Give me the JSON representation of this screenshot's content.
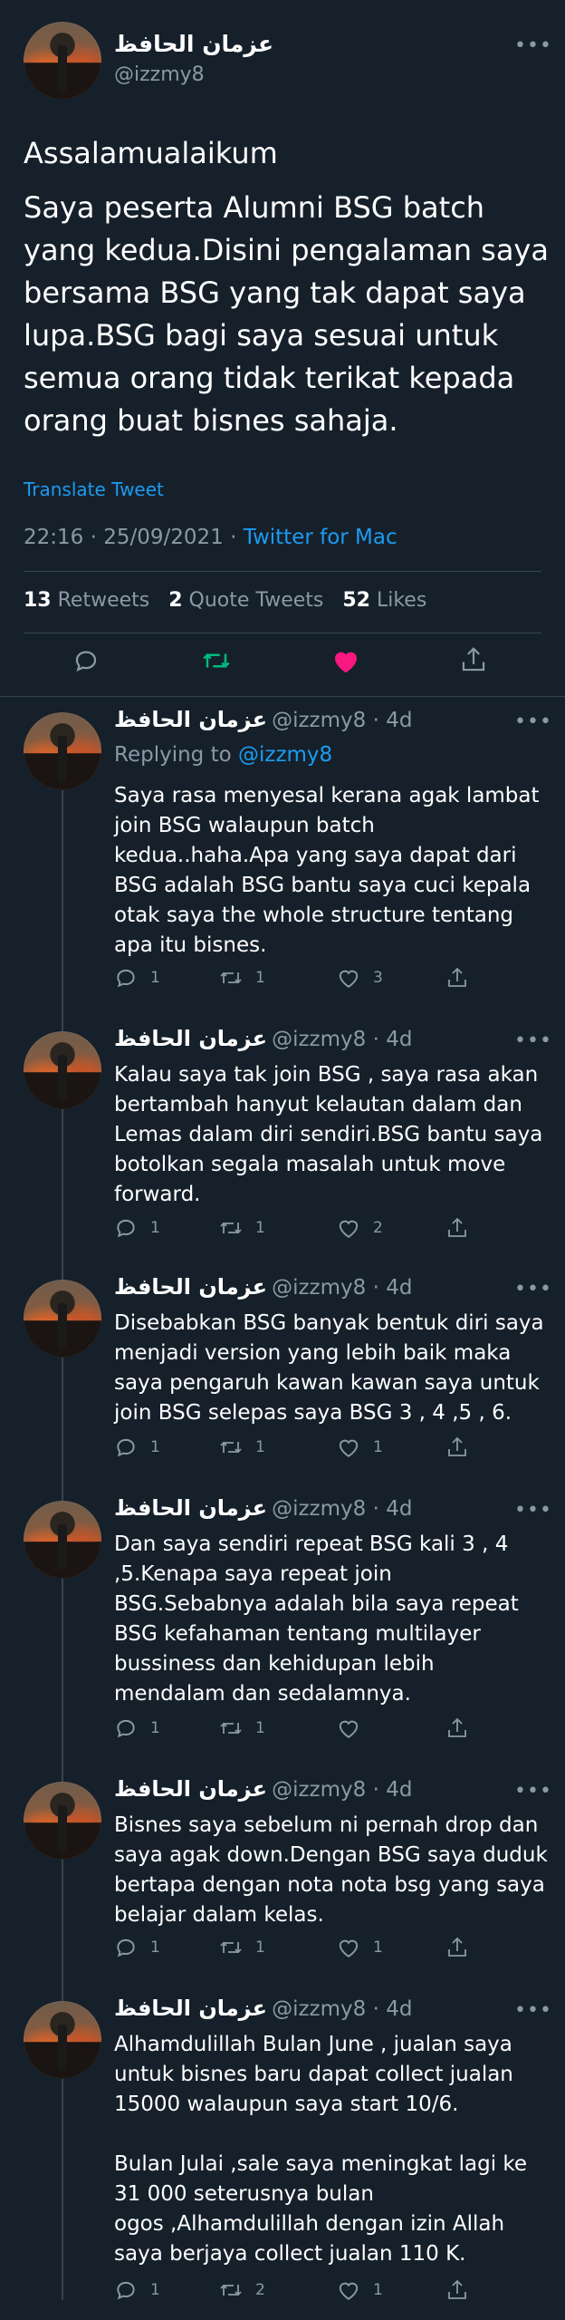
{
  "main_tweet": {
    "author_name": "عزمان الحافظ",
    "handle": "@izzmy8",
    "greeting": "Assalamualaikum",
    "body": "Saya peserta Alumni BSG batch\nyang kedua.Disini pengalaman saya\nbersama BSG yang tak dapat saya\nlupa.BSG bagi saya sesuai untuk\nsemua orang tidak terikat kepada\norang buat bisnes sahaja.",
    "translate_label": "Translate Tweet",
    "timestamp": "22:16 · 25/09/2021 · ",
    "source": "Twitter for Mac",
    "retweets_count": "13",
    "retweets_label": "Retweets",
    "quotes_count": "2",
    "quotes_label": "Quote Tweets",
    "likes_count": "52",
    "likes_label": "Likes"
  },
  "colors": {
    "background": "#15202b",
    "accent": "#1d9bf0",
    "retweet_green": "#00ba7c",
    "like_pink": "#f91880"
  },
  "replies": [
    {
      "author_name": "عزمان الحافظ",
      "meta": "@izzmy8 · 4d",
      "replying_prefix": "Replying to ",
      "replying_handle": "@izzmy8",
      "text": "Saya rasa menyesal kerana agak lambat\njoin BSG walaupun batch\nkedua..haha.Apa yang saya dapat dari\nBSG adalah BSG bantu saya cuci kepala\notak saya the whole structure tentang\napa itu bisnes.",
      "replies": "1",
      "retweets": "1",
      "likes": "3"
    },
    {
      "author_name": "عزمان الحافظ",
      "meta": "@izzmy8 · 4d",
      "text": "Kalau saya tak join BSG , saya rasa akan\nbertambah hanyut kelautan dalam dan\nLemas dalam diri sendiri.BSG bantu saya\nbotolkan segala masalah untuk move\nforward.",
      "replies": "1",
      "retweets": "1",
      "likes": "2"
    },
    {
      "author_name": "عزمان الحافظ",
      "meta": "@izzmy8 · 4d",
      "text": "Disebabkan BSG banyak bentuk diri saya\nmenjadi version yang lebih baik maka\nsaya pengaruh kawan kawan saya untuk\njoin BSG selepas saya BSG 3 , 4 ,5 , 6.",
      "replies": "1",
      "retweets": "1",
      "likes": "1"
    },
    {
      "author_name": "عزمان الحافظ",
      "meta": "@izzmy8 · 4d",
      "text": "Dan saya sendiri repeat BSG kali 3 , 4\n,5.Kenapa saya repeat join\nBSG.Sebabnya adalah bila saya repeat\nBSG kefahaman tentang multilayer\nbussiness dan kehidupan lebih\nmendalam dan sedalamnya.",
      "replies": "1",
      "retweets": "1",
      "likes": ""
    },
    {
      "author_name": "عزمان الحافظ",
      "meta": "@izzmy8 · 4d",
      "text": "Bisnes saya sebelum ni pernah drop dan\nsaya agak down.Dengan BSG saya duduk\nbertapa dengan nota nota bsg yang saya\nbelajar dalam kelas.",
      "replies": "1",
      "retweets": "1",
      "likes": "1"
    },
    {
      "author_name": "عزمان الحافظ",
      "meta": "@izzmy8 · 4d",
      "text": "Alhamdulillah Bulan June , jualan saya\nuntuk bisnes baru dapat collect jualan\n15000 walaupun saya start 10/6.\n\nBulan Julai ,sale saya meningkat lagi ke\n31 000 seterusnya bulan\nogos ,Alhamdulillah dengan izin Allah\nsaya berjaya collect jualan 110 K.",
      "replies": "1",
      "retweets": "2",
      "likes": "1"
    }
  ]
}
